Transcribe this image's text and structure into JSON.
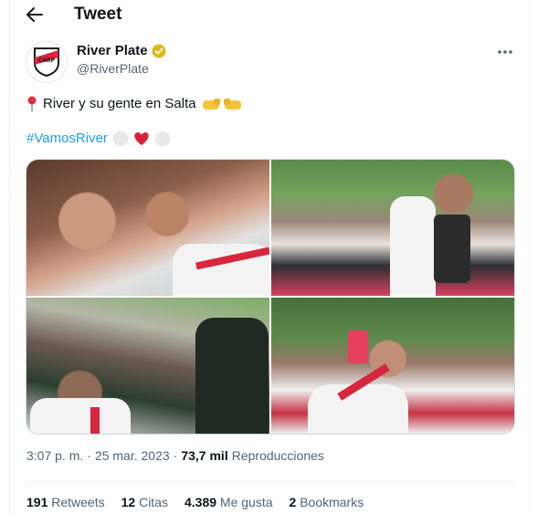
{
  "header": {
    "title": "Tweet",
    "back_icon": "arrow-left-icon"
  },
  "author": {
    "display_name": "River Plate",
    "handle": "@RiverPlate",
    "verified_color": "#e2b719",
    "more_icon": "ellipsis-icon"
  },
  "tweet": {
    "text": "River y su gente en Salta",
    "hashtag": "#VamosRiver",
    "emoji_before": "pin-icon",
    "emoji_after": "fist-bump-icon",
    "hashtag_emoji": "white-red-white-hearts"
  },
  "meta": {
    "time": "3:07 p. m.",
    "separator": "·",
    "date": "25 mar. 2023",
    "separator2": "·",
    "views": "73,7 mil",
    "views_label": "Reproducciones"
  },
  "stats": {
    "retweets_count": "191",
    "retweets_label": "Retweets",
    "quotes_count": "12",
    "quotes_label": "Citas",
    "likes_count": "4.389",
    "likes_label": "Me gusta",
    "bookmarks_count": "2",
    "bookmarks_label": "Bookmarks"
  },
  "colors": {
    "accent": "#1d9bf0",
    "brand_red": "#d7263d",
    "text": "#0f1419",
    "muted": "#536471"
  }
}
